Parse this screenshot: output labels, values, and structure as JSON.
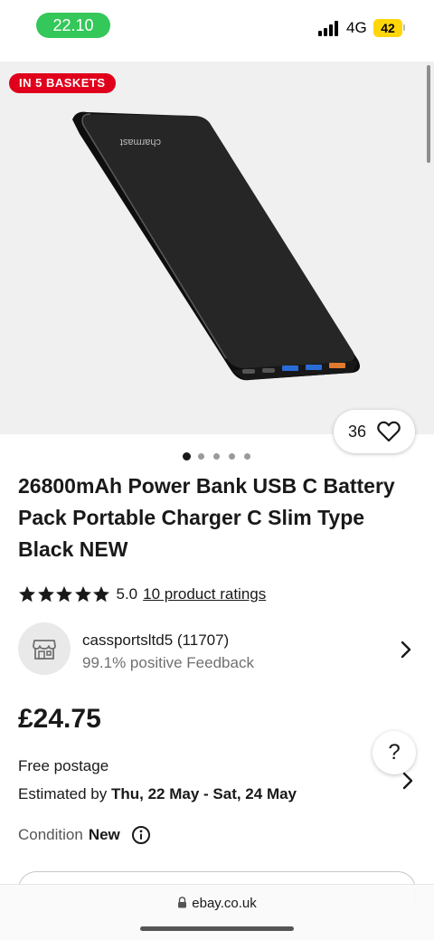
{
  "status_bar": {
    "time": "22.10",
    "network": "4G",
    "battery": "42"
  },
  "gallery": {
    "badge": "IN 5 BASKETS",
    "brand_print": "charmast",
    "watch_count": "36",
    "image_count": 5,
    "active_image": 0
  },
  "product": {
    "title": "26800mAh Power Bank USB C Battery Pack Portable Charger C Slim Type Black NEW",
    "rating_value": "5.0",
    "rating_count": "10 product ratings",
    "stars": 5
  },
  "seller": {
    "name": "cassportsltd5 (11707)",
    "feedback": "99.1% positive Feedback"
  },
  "price": {
    "amount": "£24.75"
  },
  "shipping": {
    "postage": "Free postage",
    "estimate_label": "Estimated by ",
    "estimate_dates": "Thu, 22 May - Sat, 24 May"
  },
  "condition": {
    "label": "Condition",
    "value": "New"
  },
  "help": {
    "label": "?"
  },
  "browser": {
    "url": "ebay.co.uk"
  },
  "colors": {
    "badge_red": "#e0001b",
    "time_green": "#34c759",
    "battery_yellow": "#ffd60a",
    "image_bg": "#f0f0f0"
  }
}
